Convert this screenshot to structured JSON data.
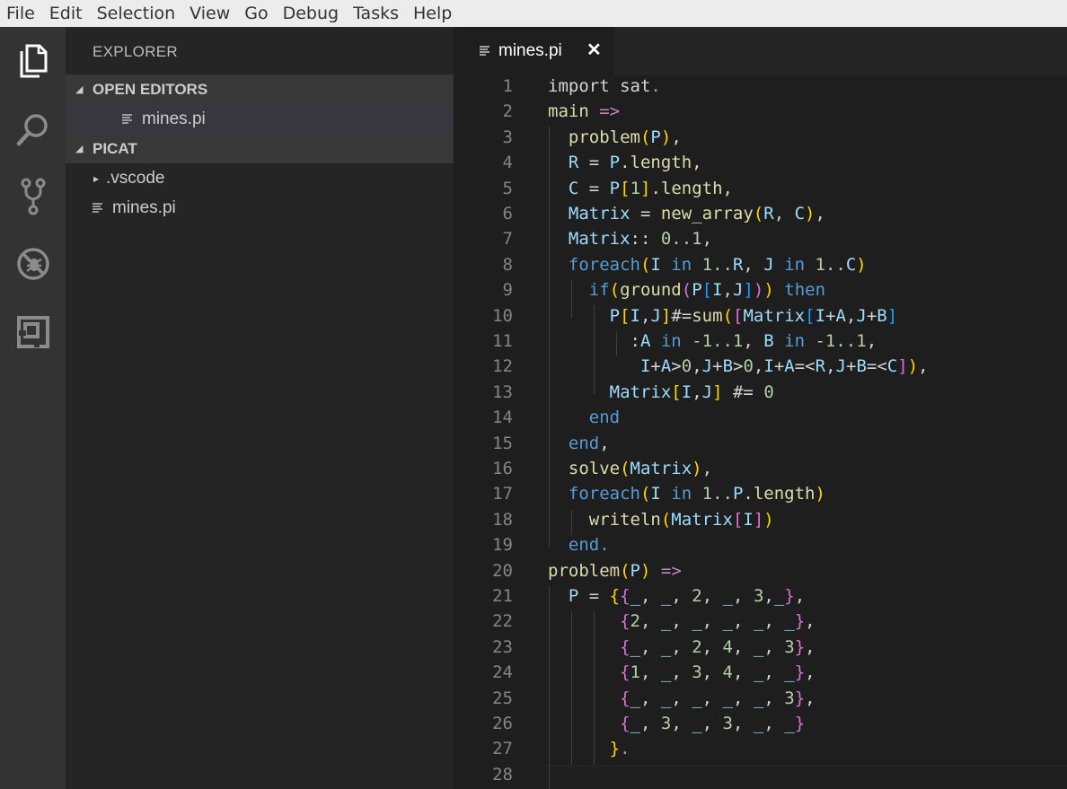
{
  "menu": [
    "File",
    "Edit",
    "Selection",
    "View",
    "Go",
    "Debug",
    "Tasks",
    "Help"
  ],
  "activity_bar": [
    {
      "name": "explorer-icon"
    },
    {
      "name": "search-icon"
    },
    {
      "name": "source-control-icon"
    },
    {
      "name": "debug-icon"
    },
    {
      "name": "extensions-icon"
    }
  ],
  "sidebar": {
    "title": "EXPLORER",
    "open_editors": {
      "label": "OPEN EDITORS",
      "items": [
        {
          "label": "mines.pi"
        }
      ]
    },
    "folder": {
      "label": "PICAT",
      "items": [
        {
          "label": ".vscode",
          "type": "folder"
        },
        {
          "label": "mines.pi",
          "type": "file"
        }
      ]
    }
  },
  "tab": {
    "label": "mines.pi",
    "close": "✕"
  },
  "editor": {
    "lines": [
      [
        [
          "import sat",
          "op"
        ],
        [
          ".",
          "kc"
        ]
      ],
      [
        [
          "main ",
          "fn"
        ],
        [
          "=>",
          "kc"
        ]
      ],
      [
        [
          "  problem",
          "fn"
        ],
        [
          "(",
          "br1"
        ],
        [
          "P",
          "vr"
        ],
        [
          ")",
          "br1"
        ],
        [
          ",",
          "op"
        ]
      ],
      [
        [
          "  R",
          "vr"
        ],
        [
          " = ",
          "op"
        ],
        [
          "P",
          "vr"
        ],
        [
          ".length,",
          "fn"
        ]
      ],
      [
        [
          "  C",
          "vr"
        ],
        [
          " = ",
          "op"
        ],
        [
          "P",
          "vr"
        ],
        [
          "[",
          "br1"
        ],
        [
          "1",
          "nm"
        ],
        [
          "]",
          "br1"
        ],
        [
          ".length,",
          "fn"
        ]
      ],
      [
        [
          "  Matrix",
          "vr"
        ],
        [
          " = ",
          "op"
        ],
        [
          "new_array",
          "fn"
        ],
        [
          "(",
          "br1"
        ],
        [
          "R",
          "vr"
        ],
        [
          ", ",
          "op"
        ],
        [
          "C",
          "vr"
        ],
        [
          ")",
          "br1"
        ],
        [
          ",",
          "op"
        ]
      ],
      [
        [
          "  Matrix",
          "vr"
        ],
        [
          ":: ",
          "op"
        ],
        [
          "0..1",
          "nm"
        ],
        [
          ",",
          "op"
        ]
      ],
      [
        [
          "  foreach",
          "kw"
        ],
        [
          "(",
          "br1"
        ],
        [
          "I",
          "vr"
        ],
        [
          " in ",
          "kw"
        ],
        [
          "1..",
          "nm"
        ],
        [
          "R",
          "vr"
        ],
        [
          ", ",
          "op"
        ],
        [
          "J",
          "vr"
        ],
        [
          " in ",
          "kw"
        ],
        [
          "1..",
          "nm"
        ],
        [
          "C",
          "vr"
        ],
        [
          ")",
          "br1"
        ]
      ],
      [
        [
          "    if",
          "kw"
        ],
        [
          "(",
          "br1"
        ],
        [
          "ground",
          "fn"
        ],
        [
          "(",
          "br2"
        ],
        [
          "P",
          "vr"
        ],
        [
          "[",
          "br3"
        ],
        [
          "I",
          "vr"
        ],
        [
          ",",
          "op"
        ],
        [
          "J",
          "vr"
        ],
        [
          "]",
          "br3"
        ],
        [
          ")",
          "br2"
        ],
        [
          ")",
          "br1"
        ],
        [
          " then",
          "kw"
        ]
      ],
      [
        [
          "      P",
          "vr"
        ],
        [
          "[",
          "br1"
        ],
        [
          "I",
          "vr"
        ],
        [
          ",",
          "op"
        ],
        [
          "J",
          "vr"
        ],
        [
          "]",
          "br1"
        ],
        [
          "#=",
          "op"
        ],
        [
          "sum",
          "fn"
        ],
        [
          "(",
          "br1"
        ],
        [
          "[",
          "br2"
        ],
        [
          "Matrix",
          "vr"
        ],
        [
          "[",
          "br3"
        ],
        [
          "I",
          "vr"
        ],
        [
          "+",
          "op"
        ],
        [
          "A",
          "vr"
        ],
        [
          ",",
          "op"
        ],
        [
          "J",
          "vr"
        ],
        [
          "+",
          "op"
        ],
        [
          "B",
          "vr"
        ],
        [
          "]",
          "br3"
        ]
      ],
      [
        [
          "        :",
          "op"
        ],
        [
          "A",
          "vr"
        ],
        [
          " in ",
          "kw"
        ],
        [
          "-1..1",
          "nm"
        ],
        [
          ", ",
          "op"
        ],
        [
          "B",
          "vr"
        ],
        [
          " in ",
          "kw"
        ],
        [
          "-1..1",
          "nm"
        ],
        [
          ",",
          "op"
        ]
      ],
      [
        [
          "         I",
          "vr"
        ],
        [
          "+",
          "op"
        ],
        [
          "A",
          "vr"
        ],
        [
          ">",
          "op"
        ],
        [
          "0",
          "nm"
        ],
        [
          ",",
          "op"
        ],
        [
          "J",
          "vr"
        ],
        [
          "+",
          "op"
        ],
        [
          "B",
          "vr"
        ],
        [
          ">",
          "op"
        ],
        [
          "0",
          "nm"
        ],
        [
          ",",
          "op"
        ],
        [
          "I",
          "vr"
        ],
        [
          "+",
          "op"
        ],
        [
          "A",
          "vr"
        ],
        [
          "=<",
          "op"
        ],
        [
          "R",
          "vr"
        ],
        [
          ",",
          "op"
        ],
        [
          "J",
          "vr"
        ],
        [
          "+",
          "op"
        ],
        [
          "B",
          "vr"
        ],
        [
          "=<",
          "op"
        ],
        [
          "C",
          "vr"
        ],
        [
          "]",
          "br2"
        ],
        [
          ")",
          "br1"
        ],
        [
          ",",
          "op"
        ]
      ],
      [
        [
          "      Matrix",
          "vr"
        ],
        [
          "[",
          "br1"
        ],
        [
          "I",
          "vr"
        ],
        [
          ",",
          "op"
        ],
        [
          "J",
          "vr"
        ],
        [
          "]",
          "br1"
        ],
        [
          " #= ",
          "op"
        ],
        [
          "0",
          "nm"
        ]
      ],
      [
        [
          "    end",
          "kw"
        ]
      ],
      [
        [
          "  end",
          "kw"
        ],
        [
          ",",
          "op"
        ]
      ],
      [
        [
          "  solve",
          "fn"
        ],
        [
          "(",
          "br1"
        ],
        [
          "Matrix",
          "vr"
        ],
        [
          ")",
          "br1"
        ],
        [
          ",",
          "op"
        ]
      ],
      [
        [
          "  foreach",
          "kw"
        ],
        [
          "(",
          "br1"
        ],
        [
          "I",
          "vr"
        ],
        [
          " in ",
          "kw"
        ],
        [
          "1..",
          "nm"
        ],
        [
          "P",
          "vr"
        ],
        [
          ".length",
          "fn"
        ],
        [
          ")",
          "br1"
        ]
      ],
      [
        [
          "    writeln",
          "fn"
        ],
        [
          "(",
          "br1"
        ],
        [
          "Matrix",
          "vr"
        ],
        [
          "[",
          "br2"
        ],
        [
          "I",
          "vr"
        ],
        [
          "]",
          "br2"
        ],
        [
          ")",
          "br1"
        ]
      ],
      [
        [
          "  end.",
          "kw"
        ]
      ],
      [
        [
          "problem",
          "fn"
        ],
        [
          "(",
          "br1"
        ],
        [
          "P",
          "vr"
        ],
        [
          ")",
          "br1"
        ],
        [
          " =>",
          "kc"
        ]
      ],
      [
        [
          "  P",
          "vr"
        ],
        [
          " = ",
          "op"
        ],
        [
          "{",
          "br1"
        ],
        [
          "{",
          "br2"
        ],
        [
          "_",
          "vr"
        ],
        [
          ", ",
          "op"
        ],
        [
          "_",
          "vr"
        ],
        [
          ", ",
          "op"
        ],
        [
          "2",
          "nm"
        ],
        [
          ", ",
          "op"
        ],
        [
          "_",
          "vr"
        ],
        [
          ", ",
          "op"
        ],
        [
          "3",
          "nm"
        ],
        [
          ",",
          "op"
        ],
        [
          "_",
          "vr"
        ],
        [
          "}",
          "br2"
        ],
        [
          ",",
          "op"
        ]
      ],
      [
        [
          "       {",
          "br2"
        ],
        [
          "2",
          "nm"
        ],
        [
          ", ",
          "op"
        ],
        [
          "_",
          "vr"
        ],
        [
          ", ",
          "op"
        ],
        [
          "_",
          "vr"
        ],
        [
          ", ",
          "op"
        ],
        [
          "_",
          "vr"
        ],
        [
          ", ",
          "op"
        ],
        [
          "_",
          "vr"
        ],
        [
          ", ",
          "op"
        ],
        [
          "_",
          "vr"
        ],
        [
          "}",
          "br2"
        ],
        [
          ",",
          "op"
        ]
      ],
      [
        [
          "       {",
          "br2"
        ],
        [
          "_",
          "vr"
        ],
        [
          ", ",
          "op"
        ],
        [
          "_",
          "vr"
        ],
        [
          ", ",
          "op"
        ],
        [
          "2",
          "nm"
        ],
        [
          ", ",
          "op"
        ],
        [
          "4",
          "nm"
        ],
        [
          ", ",
          "op"
        ],
        [
          "_",
          "vr"
        ],
        [
          ", ",
          "op"
        ],
        [
          "3",
          "nm"
        ],
        [
          "}",
          "br2"
        ],
        [
          ",",
          "op"
        ]
      ],
      [
        [
          "       {",
          "br2"
        ],
        [
          "1",
          "nm"
        ],
        [
          ", ",
          "op"
        ],
        [
          "_",
          "vr"
        ],
        [
          ", ",
          "op"
        ],
        [
          "3",
          "nm"
        ],
        [
          ", ",
          "op"
        ],
        [
          "4",
          "nm"
        ],
        [
          ", ",
          "op"
        ],
        [
          "_",
          "vr"
        ],
        [
          ", ",
          "op"
        ],
        [
          "_",
          "vr"
        ],
        [
          "}",
          "br2"
        ],
        [
          ",",
          "op"
        ]
      ],
      [
        [
          "       {",
          "br2"
        ],
        [
          "_",
          "vr"
        ],
        [
          ", ",
          "op"
        ],
        [
          "_",
          "vr"
        ],
        [
          ", ",
          "op"
        ],
        [
          "_",
          "vr"
        ],
        [
          ", ",
          "op"
        ],
        [
          "_",
          "vr"
        ],
        [
          ", ",
          "op"
        ],
        [
          "_",
          "vr"
        ],
        [
          ", ",
          "op"
        ],
        [
          "3",
          "nm"
        ],
        [
          "}",
          "br2"
        ],
        [
          ",",
          "op"
        ]
      ],
      [
        [
          "       {",
          "br2"
        ],
        [
          "_",
          "vr"
        ],
        [
          ", ",
          "op"
        ],
        [
          "3",
          "nm"
        ],
        [
          ", ",
          "op"
        ],
        [
          "_",
          "vr"
        ],
        [
          ", ",
          "op"
        ],
        [
          "3",
          "nm"
        ],
        [
          ", ",
          "op"
        ],
        [
          "_",
          "vr"
        ],
        [
          ", ",
          "op"
        ],
        [
          "_",
          "vr"
        ],
        [
          "}",
          "br2"
        ]
      ],
      [
        [
          "      }",
          "br1"
        ],
        [
          ".",
          "kc"
        ]
      ],
      [
        [
          "",
          "op"
        ]
      ]
    ]
  }
}
